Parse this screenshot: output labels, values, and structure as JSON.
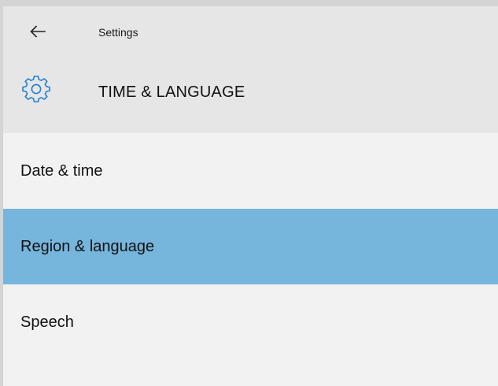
{
  "app": {
    "title": "Settings"
  },
  "section": {
    "title": "TIME & LANGUAGE",
    "icon": "gear-icon",
    "accent_color": "#1f7fd1"
  },
  "nav": {
    "items": [
      {
        "label": "Date & time",
        "selected": false
      },
      {
        "label": "Region & language",
        "selected": true
      },
      {
        "label": "Speech",
        "selected": false
      }
    ],
    "selected_color": "#76b5dc"
  }
}
